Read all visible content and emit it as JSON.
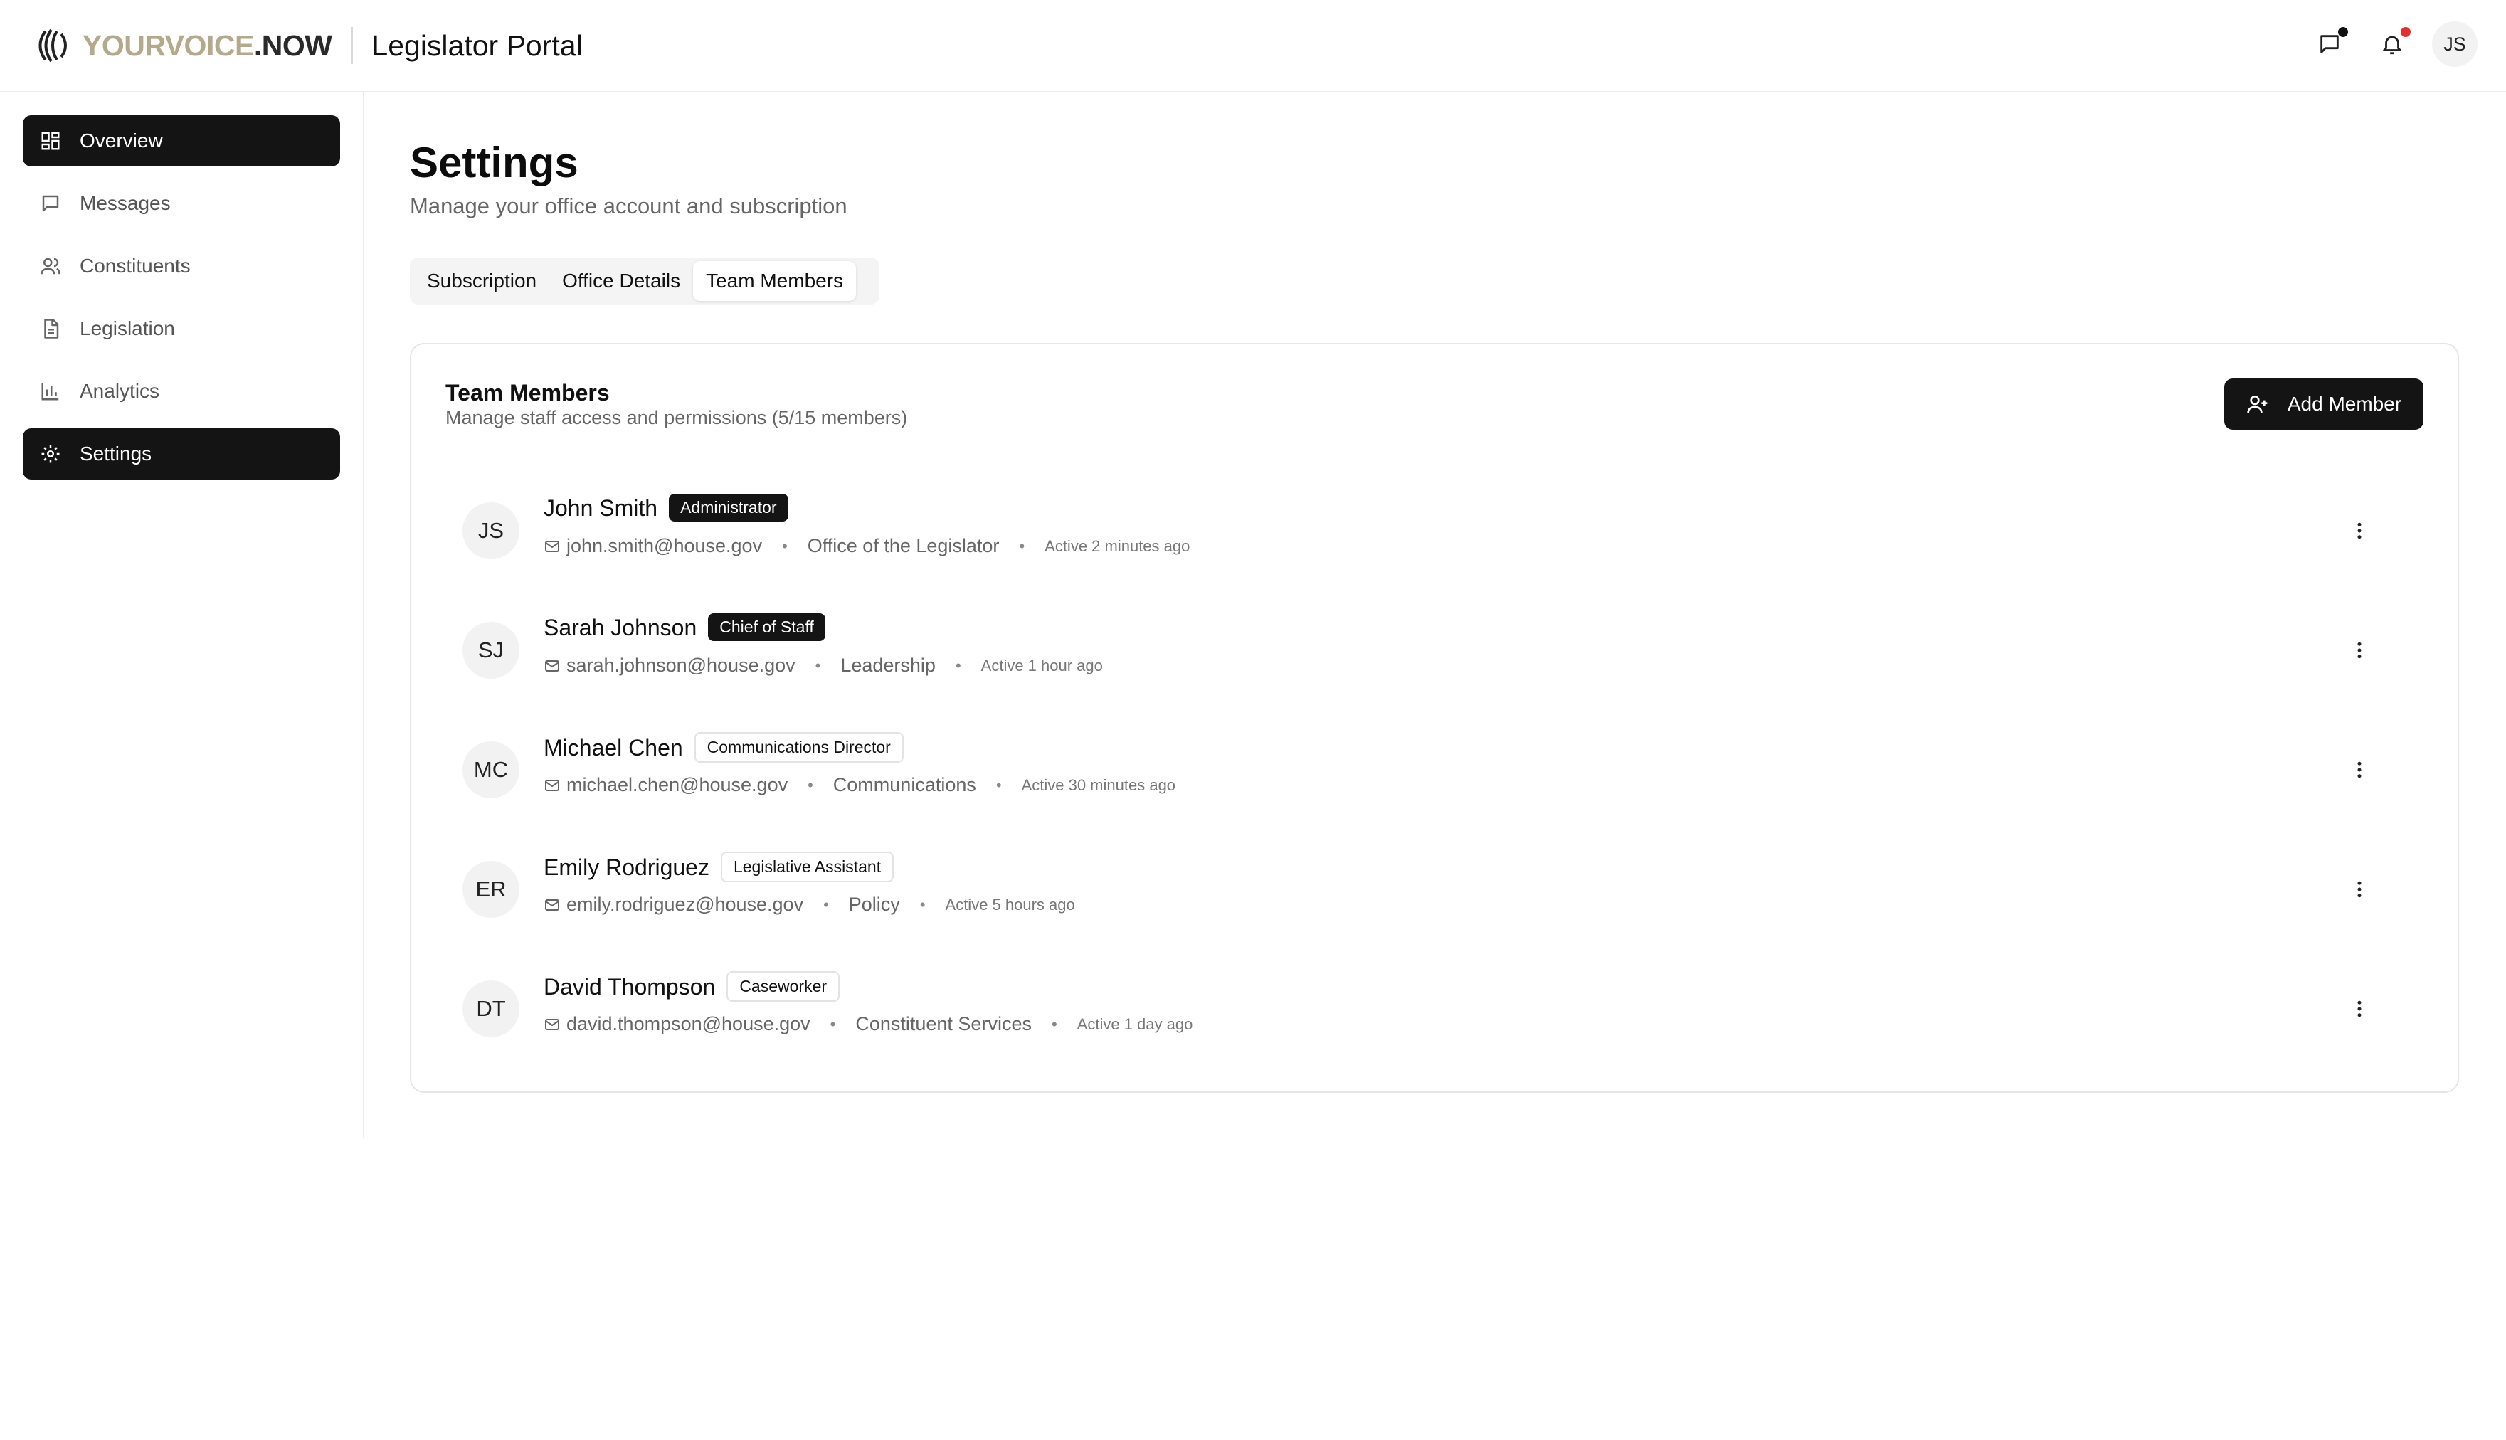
{
  "header": {
    "brand_part1": "YOURVOICE",
    "brand_part2": ".NOW",
    "portal_title": "Legislator Portal",
    "user_initials": "JS",
    "colors": {
      "brand_gold": "#b5a98c",
      "notification_dot": "#e03131",
      "message_dot": "#111111"
    }
  },
  "sidebar": {
    "items": [
      {
        "label": "Overview",
        "icon": "grid-icon"
      },
      {
        "label": "Messages",
        "icon": "message-icon"
      },
      {
        "label": "Constituents",
        "icon": "users-icon"
      },
      {
        "label": "Legislation",
        "icon": "document-icon"
      },
      {
        "label": "Analytics",
        "icon": "bar-chart-icon"
      },
      {
        "label": "Settings",
        "icon": "gear-icon"
      }
    ]
  },
  "page": {
    "title": "Settings",
    "subtitle": "Manage your office account and subscription",
    "tabs": [
      {
        "label": "Subscription"
      },
      {
        "label": "Office Details"
      },
      {
        "label": "Team Members"
      }
    ]
  },
  "team": {
    "title": "Team Members",
    "subtitle": "Manage staff access and permissions (5/15 members)",
    "add_label": "Add Member",
    "members": [
      {
        "initials": "JS",
        "name": "John Smith",
        "role": "Administrator",
        "email": "john.smith@house.gov",
        "department": "Office of the Legislator",
        "active": "Active 2 minutes ago"
      },
      {
        "initials": "SJ",
        "name": "Sarah Johnson",
        "role": "Chief of Staff",
        "email": "sarah.johnson@house.gov",
        "department": "Leadership",
        "active": "Active 1 hour ago"
      },
      {
        "initials": "MC",
        "name": "Michael Chen",
        "role": "Communications Director",
        "email": "michael.chen@house.gov",
        "department": "Communications",
        "active": "Active 30 minutes ago"
      },
      {
        "initials": "ER",
        "name": "Emily Rodriguez",
        "role": "Legislative Assistant",
        "email": "emily.rodriguez@house.gov",
        "department": "Policy",
        "active": "Active 5 hours ago"
      },
      {
        "initials": "DT",
        "name": "David Thompson",
        "role": "Caseworker",
        "email": "david.thompson@house.gov",
        "department": "Constituent Services",
        "active": "Active 1 day ago"
      }
    ]
  }
}
